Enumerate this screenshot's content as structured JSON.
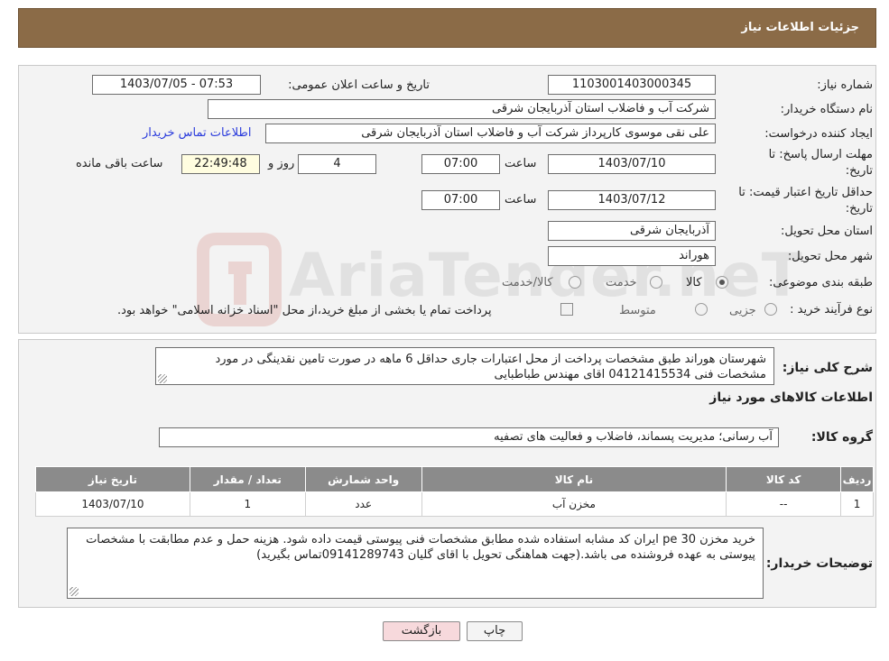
{
  "header": {
    "title": "جزئیات اطلاعات نیاز"
  },
  "form": {
    "need_number": {
      "label": "شماره نیاز:",
      "value": "1103001403000345"
    },
    "announce": {
      "label": "تاریخ و ساعت اعلان عمومی:",
      "value": "1403/07/05 - 07:53"
    },
    "buyer_org": {
      "label": "نام دستگاه خریدار:",
      "value": "شرکت آب و فاضلاب استان آذربایجان شرقی"
    },
    "creator": {
      "label": "ایجاد کننده درخواست:",
      "value": "علی نقی موسوی کارپرداز شرکت آب و فاضلاب استان آذربایجان شرقی",
      "contact_link": "اطلاعات تماس خریدار"
    },
    "deadline": {
      "label_line1": "مهلت ارسال پاسخ: تا",
      "label_line2": "تاریخ:",
      "date": "1403/07/10",
      "time_label": "ساعت",
      "time": "07:00",
      "days": "4",
      "days_label": "روز و",
      "remaining": "22:49:48",
      "remaining_label": "ساعت باقی مانده"
    },
    "validity": {
      "label_line1": "حداقل تاریخ اعتبار قیمت: تا",
      "label_line2": "تاریخ:",
      "date": "1403/07/12",
      "time_label": "ساعت",
      "time": "07:00"
    },
    "province": {
      "label": "استان محل تحویل:",
      "value": "آذربایجان شرقی"
    },
    "city": {
      "label": "شهر محل تحویل:",
      "value": "هوراند"
    },
    "category": {
      "label": "طبقه بندی موضوعی:",
      "options": [
        "کالا",
        "خدمت",
        "کالا/خدمت"
      ],
      "selected": "کالا"
    },
    "purchase_type": {
      "label": "نوع فرآیند خرید :",
      "options": [
        "جزیی",
        "متوسط"
      ],
      "note": "پرداخت تمام یا بخشی از مبلغ خرید،از محل \"اسناد خزانه اسلامی\" خواهد بود."
    }
  },
  "description": {
    "label": "شرح کلی نیاز:",
    "text": "شهرستان هوراند  طبق مشخصات پرداخت از محل اعتبارات جاری حداقل 6 ماهه در صورت تامین نقدینگی  در مورد مشخصات فنی 04121415534 اقای مهندس طباطبایی"
  },
  "goods": {
    "section_title": "اطلاعات کالاهای مورد نیاز",
    "group_label": "گروه کالا:",
    "group_value": "آب رسانی؛ مدیریت پسماند، فاضلاب و فعالیت های تصفیه",
    "columns": [
      "ردیف",
      "کد کالا",
      "نام کالا",
      "واحد شمارش",
      "تعداد / مقدار",
      "تاریخ نیاز"
    ],
    "rows": [
      [
        "1",
        "--",
        "مخزن آب",
        "عدد",
        "1",
        "1403/07/10"
      ]
    ]
  },
  "buyer_notes": {
    "label": "توضیحات خریدار:",
    "text": "خرید  مخزن 30 pe ایران کد مشابه استفاده شده مطابق مشخصات فنی پیوستی قیمت داده شود. هزینه حمل و عدم مطابقت با مشخصات پیوستی به عهده فروشنده می باشد.(جهت هماهنگی تحویل با اقای گلیان  09141289743تماس بگیرید)"
  },
  "buttons": {
    "print": "چاپ",
    "back": "بازگشت"
  },
  "watermark": {
    "text": "AriaTender.neT"
  },
  "colors": {
    "header": "#8b6b47",
    "link": "#2a3bdc",
    "table_header": "#8b8b8b",
    "back_button": "#f7d9dc"
  }
}
